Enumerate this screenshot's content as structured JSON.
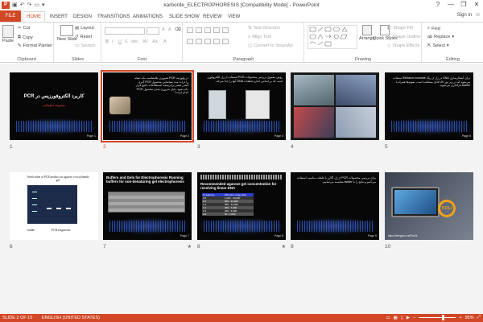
{
  "window": {
    "title": "karborde_ELECTROPHORESIS [Compatibility Mode] - PowerPoint",
    "app_icon": "P",
    "controls": [
      "?",
      "—",
      "❐",
      "✕"
    ]
  },
  "qat": [
    "save-icon",
    "undo-icon",
    "redo-icon",
    "start-from-beginning-icon",
    "customize-icon"
  ],
  "tabs": {
    "file": "FILE",
    "items": [
      "HOME",
      "INSERT",
      "DESIGN",
      "TRANSITIONS",
      "ANIMATIONS",
      "SLIDE SHOW",
      "REVIEW",
      "VIEW"
    ],
    "active": "HOME",
    "signin": "Sign in"
  },
  "ribbon": {
    "clipboard": {
      "label": "Clipboard",
      "paste": "Paste",
      "cut": "Cut",
      "copy": "Copy",
      "format_painter": "Format Painter"
    },
    "slides": {
      "label": "Slides",
      "new_slide": "New Slide",
      "layout": "Layout",
      "reset": "Reset",
      "section": "Section"
    },
    "font": {
      "label": "Font",
      "font_name": "",
      "font_size": "",
      "grow": "A",
      "shrink": "A",
      "bold": "B",
      "italic": "I",
      "underline": "U",
      "strike": "S",
      "shadow": "abc",
      "spacing": "AV",
      "case": "Aa",
      "color": "A"
    },
    "paragraph": {
      "label": "Paragraph",
      "text_direction": "Text Direction",
      "align_text": "Align Text",
      "smartart": "Convert to SmartArt"
    },
    "drawing": {
      "label": "Drawing",
      "arrange": "Arrange",
      "quick_styles": "Quick Styles",
      "shape_fill": "Shape Fill",
      "shape_outline": "Shape Outline",
      "shape_effects": "Shape Effects"
    },
    "editing": {
      "label": "Editing",
      "find": "Find",
      "replace": "Replace",
      "select": "Select"
    }
  },
  "slides": [
    {
      "number": "1",
      "title": "کاربرد الکتروفورزیس در PCR",
      "subtitle": "مجموعه تحقیقاتی",
      "page": "Page 1"
    },
    {
      "number": "2",
      "text": "در ولوژنت PCR تصویری بلامتناسب باید نتیجه را ذرات ثبت شناسایی محصول PCR گیری آنقدر معتبر برابرنتیجه استطلاعات دقیق قرار داده شود. دلیل ضروری شدن محصول PCR کدام است؟",
      "page": "Page 2",
      "selected": true
    },
    {
      "number": "3",
      "text": "روش معمول بررسی محصولات PCR استفاده از ژل الکتروفورز است که بر اساس اندازه قطعات DNA آنها را جدا می‌کند.",
      "page": "Page 3"
    },
    {
      "number": "4",
      "page": ""
    },
    {
      "number": "5",
      "text": "برای آشکارسازی DNA در ژل از رنگ Ethidium bromide استفاده می‌شود که در زیر نور UV قابل مشاهده است. نمونه‌ها همراه با ladder بارگذاری می‌شوند.",
      "page": "Page 5"
    },
    {
      "number": "6",
      "title": "Verification of PCR product on agarose or acrylamide gel",
      "labels": [
        "ladder",
        "PCR fragments"
      ],
      "page": ""
    },
    {
      "number": "7",
      "title": "Buffers and Gels for Electrophoresis Running buffers for non-denaturing gel electrophoresis",
      "page": "Page 7",
      "has_animation": true
    },
    {
      "number": "8",
      "title": "Recommended agarose gel concentration for resolving linear DNA",
      "header": [
        "% agarose",
        "DNA size range (bp)"
      ],
      "rows": [
        [
          "0.5",
          "1,000 - 30,000"
        ],
        [
          "0.7",
          "800 - 12,000"
        ],
        [
          "1.0",
          "500 - 10,000"
        ],
        [
          "1.2",
          "400 - 7,000"
        ],
        [
          "1.5",
          "200 - 3,000"
        ],
        [
          "2.0",
          "50 - 2,000"
        ]
      ],
      "page": "Page 8",
      "has_animation": true
    },
    {
      "number": "9",
      "text": "برای بررسی محصولات PCR از ژل آگارز با غلظت مناسب استفاده می‌کنیم و نتایج را با ladder مقایسه می‌نماییم.",
      "page": "Page 9"
    },
    {
      "number": "10",
      "brand": "P.DLi",
      "url": "https://telegram.me/ProDL",
      "page": ""
    }
  ],
  "status": {
    "slide": "SLIDE 2 OF 10",
    "language": "ENGLISH (UNITED STATES)",
    "zoom": "95%",
    "zoom_fraction": 0.66
  },
  "colors": {
    "accent": "#d24726",
    "selected_outline": "#d24726"
  }
}
